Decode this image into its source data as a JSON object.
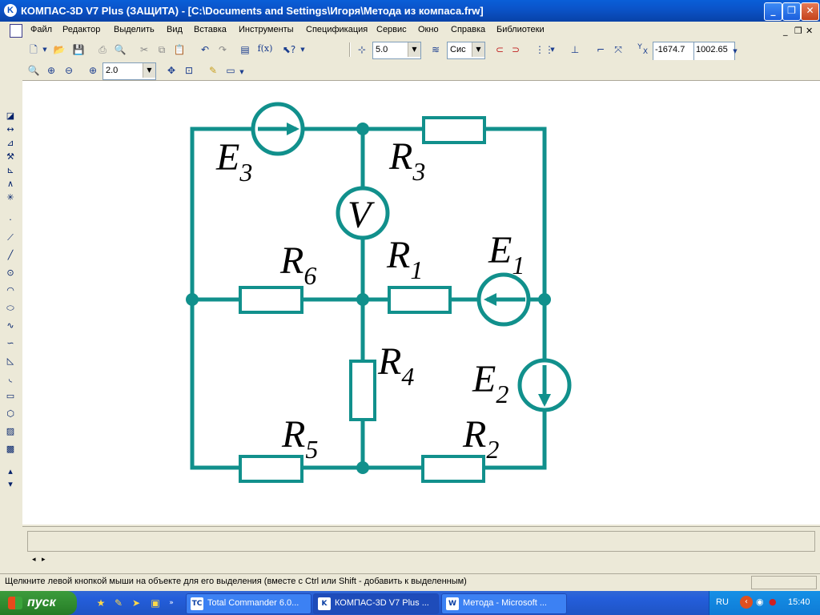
{
  "window": {
    "title": "КОМПАС-3D V7 Plus (ЗАЩИТА) - [C:\\Documents and Settings\\Игоря\\Метода из компаса.frw]"
  },
  "menu": {
    "items": [
      "Файл",
      "Редактор",
      "Выделить",
      "Вид",
      "Вставка",
      "Инструменты",
      "Спецификация",
      "Сервис",
      "Окно",
      "Справка",
      "Библиотеки"
    ]
  },
  "toolbar_main": {
    "grid_step": "5.0",
    "style": "Сис",
    "coord_x_label": "Y",
    "coord_y_label": "X",
    "coord_x": "-1674.7",
    "coord_y": "1002.65"
  },
  "toolbar_view": {
    "zoom": "2.0"
  },
  "circuit": {
    "color": "#11908c",
    "labels": {
      "E3_main": "E",
      "E3_sub": "3",
      "R3_main": "R",
      "R3_sub": "3",
      "V": "V",
      "R6_main": "R",
      "R6_sub": "6",
      "R1_main": "R",
      "R1_sub": "1",
      "E1_main": "E",
      "E1_sub": "1",
      "R4_main": "R",
      "R4_sub": "4",
      "E2_main": "E",
      "E2_sub": "2",
      "R5_main": "R",
      "R5_sub": "5",
      "R2_main": "R",
      "R2_sub": "2"
    }
  },
  "status": {
    "message": "Щелкните левой кнопкой мыши на объекте для его выделения (вместе с Ctrl или Shift - добавить к выделенным)"
  },
  "taskbar": {
    "start_label": "пуск",
    "tasks": [
      {
        "label": "Total Commander 6.0...",
        "icon_text": "TC"
      },
      {
        "label": "КОМПАС-3D V7 Plus ...",
        "icon_text": "K"
      },
      {
        "label": "Метода - Microsoft ...",
        "icon_text": "W"
      }
    ],
    "language": "RU",
    "clock": "15:40"
  }
}
